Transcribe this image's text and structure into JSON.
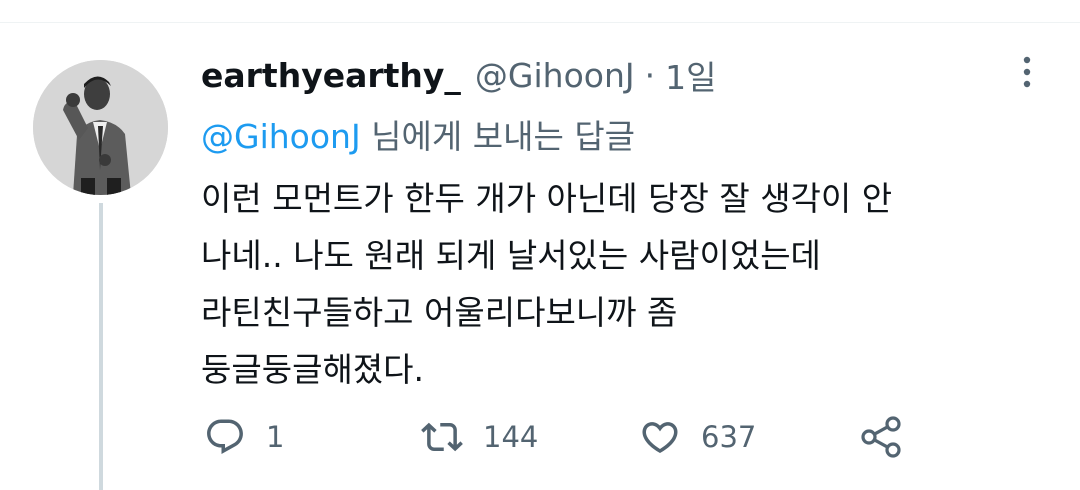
{
  "tweet": {
    "display_name": "earthyearthy_",
    "handle": "@GihoonJ",
    "separator": "·",
    "time": "1일",
    "reply_to": {
      "mention": "@GihoonJ",
      "suffix": " 님에게 보내는 답글"
    },
    "text_lines": [
      "이런 모먼트가 한두 개가 아닌데 당장 잘 생각이 안",
      "나네.. 나도 원래 되게 날서있는 사람이었는데",
      "라틴친구들하고 어울리다보니까 좀",
      "둥글둥글해졌다."
    ],
    "stats": {
      "replies": "1",
      "retweets": "144",
      "likes": "637"
    }
  },
  "icons": {
    "more": "more-vertical-icon",
    "reply": "reply-icon",
    "retweet": "retweet-icon",
    "like": "heart-icon",
    "share": "share-icon"
  },
  "colors": {
    "text": "#0f1419",
    "secondary": "#536471",
    "mention": "#1d9bf0",
    "thread_line": "#cfd9de",
    "divider": "#eff3f4"
  }
}
